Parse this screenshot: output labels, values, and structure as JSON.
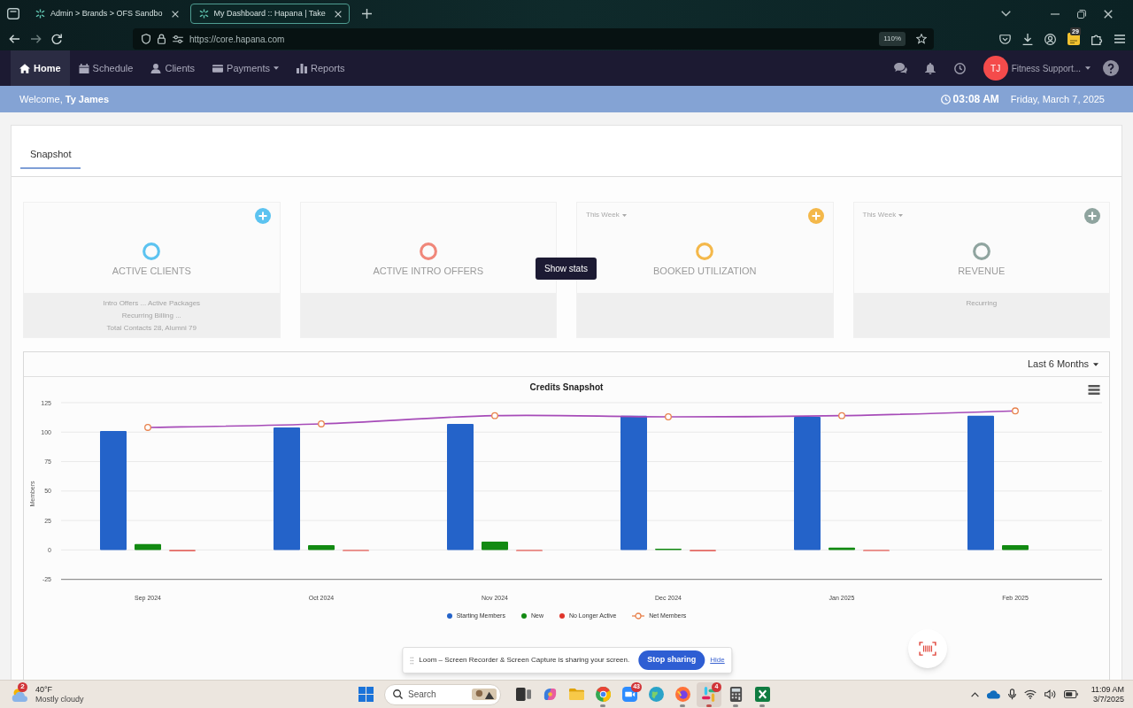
{
  "browser": {
    "tabs": [
      {
        "title": "Admin > Brands > OFS Sandbo",
        "selected": false
      },
      {
        "title": "My Dashboard :: Hapana | Take",
        "selected": true
      }
    ],
    "url": "https://core.hapana.com",
    "zoom": "110%",
    "extension_badge": "29"
  },
  "nav": {
    "items": [
      {
        "label": "Home",
        "selected": true,
        "dropdown": false
      },
      {
        "label": "Schedule",
        "selected": false,
        "dropdown": false
      },
      {
        "label": "Clients",
        "selected": false,
        "dropdown": false
      },
      {
        "label": "Payments",
        "selected": false,
        "dropdown": true
      },
      {
        "label": "Reports",
        "selected": false,
        "dropdown": false
      }
    ],
    "user": {
      "initials": "TJ",
      "name": "Fitness Support..."
    }
  },
  "welcome": {
    "greeting": "Welcome, **Ty James**",
    "time": "03:08 AM",
    "date": "Friday, March 7, 2025"
  },
  "page_tabs": [
    {
      "label": "Snapshot",
      "selected": true
    }
  ],
  "stat_cards": [
    {
      "title": "ACTIVE CLIENTS",
      "color": "#5cc3f0",
      "add_button": true,
      "footer": [
        "Intro Offers ... Active Packages",
        "Recurring Billing ...",
        "Total Contacts 28, Alumni 79"
      ]
    },
    {
      "title": "ACTIVE INTRO OFFERS",
      "color": "#f0877a",
      "add_button": false
    },
    {
      "title": "BOOKED UTILIZATION",
      "color": "#f4b84a",
      "add_button": true,
      "period": "This Week"
    },
    {
      "title": "REVENUE",
      "color": "#8fa49f",
      "add_button": true,
      "period": "This Week",
      "footer": [
        "Recurring"
      ]
    }
  ],
  "tooltip": "Show stats",
  "chart_panel": {
    "range": "Last 6 Months",
    "chart_data": {
      "type": "bar",
      "title": "Credits Snapshot",
      "ylabel": "Members",
      "categories": [
        "Sep 2024",
        "Oct 2024",
        "Nov 2024",
        "Dec 2024",
        "Jan 2025",
        "Feb 2025"
      ],
      "series": [
        {
          "name": "Starting Members",
          "color": "#2463c9",
          "values": [
            101,
            104,
            107,
            114,
            113,
            114
          ]
        },
        {
          "name": "New",
          "color": "#128a12",
          "values": [
            5,
            4,
            7,
            1,
            2,
            4
          ]
        },
        {
          "name": "No Longer Active",
          "color": "#e0352b",
          "values": [
            -1,
            -0.5,
            -0.5,
            -1,
            -0.5,
            0
          ]
        },
        {
          "name": "Net Members",
          "type": "line",
          "color": "#a64bb8",
          "marker": "circle",
          "values": [
            104,
            107,
            114,
            113,
            114,
            118
          ]
        }
      ],
      "ylim": [
        -25,
        125
      ],
      "yticks": [
        -25,
        0,
        25,
        50,
        75,
        100,
        125
      ],
      "grid": true,
      "legend": "bottom"
    }
  },
  "loom": {
    "message": "Loom – Screen Recorder & Screen Capture is sharing your screen.",
    "stop_button": "Stop sharing",
    "hide_link": "Hide"
  },
  "taskbar": {
    "weather": {
      "badge": "2",
      "temperature": "40°F",
      "condition": "Mostly cloudy"
    },
    "search_placeholder": "Search",
    "apps": [
      {
        "running": false,
        "selected": false
      },
      {
        "running": false,
        "selected": false
      },
      {
        "running": false,
        "selected": false
      },
      {
        "running": true,
        "selected": false
      },
      {
        "running": false,
        "selected": false,
        "badge": "43"
      },
      {
        "running": false,
        "selected": false
      },
      {
        "running": true,
        "selected": false
      },
      {
        "running": true,
        "selected": true,
        "badge": "4"
      },
      {
        "running": true,
        "selected": false
      },
      {
        "running": true,
        "selected": false
      }
    ],
    "time": "11:09 AM",
    "date": "3/7/2025"
  }
}
